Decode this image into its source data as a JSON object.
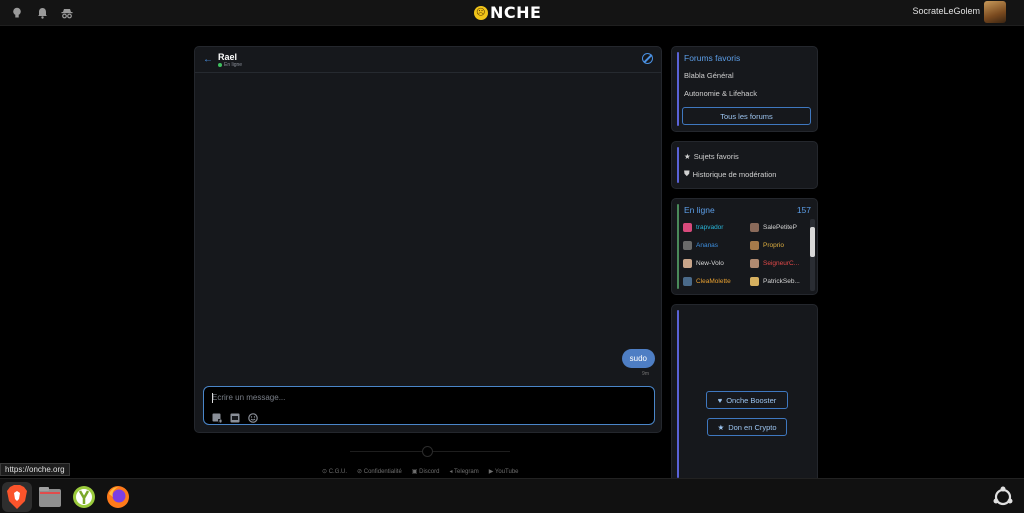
{
  "topbar": {
    "logo_text": "NCHE",
    "logo_face": "☹",
    "username": "SocrateLeGolem",
    "icons": [
      "lightbulb-icon",
      "bell-icon",
      "incognito-icon"
    ]
  },
  "chat": {
    "contact_name": "Rael",
    "contact_status": "En ligne",
    "messages": [
      {
        "text": "sudo",
        "time": "9m",
        "from": "self"
      }
    ],
    "composer_placeholder": "Ecrire un message..."
  },
  "footer": {
    "links": [
      "C.G.U.",
      "Confidentialité",
      "Discord",
      "Telegram",
      "YouTube"
    ]
  },
  "favorites": {
    "title": "Forums favoris",
    "items": [
      "Blabla Général",
      "Autonomie & Lifehack"
    ],
    "all_button": "Tous les forums"
  },
  "quicklinks": {
    "items": [
      {
        "icon": "★",
        "label": "Sujets favoris"
      },
      {
        "icon": "⛊",
        "label": "Historique de modération"
      }
    ]
  },
  "online": {
    "title": "En ligne",
    "count": "157",
    "users": [
      {
        "name": "trapvador",
        "color": "#29b6d9",
        "avatar": "#d84a7c"
      },
      {
        "name": "SalePetiteP",
        "color": "#d6d6d6",
        "avatar": "#8a6a5a"
      },
      {
        "name": "Ananas",
        "color": "#3d8fe0",
        "avatar": "#6a6a6a"
      },
      {
        "name": "Proprio",
        "color": "#e0b040",
        "avatar": "#a67a4a"
      },
      {
        "name": "New-Volo",
        "color": "#d6d6d6",
        "avatar": "#c9a58a"
      },
      {
        "name": "SeigneurC...",
        "color": "#e04848",
        "avatar": "#b08a70"
      },
      {
        "name": "CleaMolette",
        "color": "#e8a030",
        "avatar": "#4a6a8a"
      },
      {
        "name": "PatrickSeb...",
        "color": "#d6d6d6",
        "avatar": "#d6b060"
      }
    ]
  },
  "support": {
    "booster_label": "Onche Booster",
    "crypto_label": "Don en Crypto"
  },
  "browser": {
    "status_url": "https://onche.org"
  },
  "dock": {
    "apps": [
      "brave-browser",
      "files",
      "yubikey-app",
      "firefox"
    ]
  },
  "colors": {
    "accent": "#4a90e2",
    "bubble": "#4e7ec4",
    "panel_bar": "#5a63d8"
  }
}
